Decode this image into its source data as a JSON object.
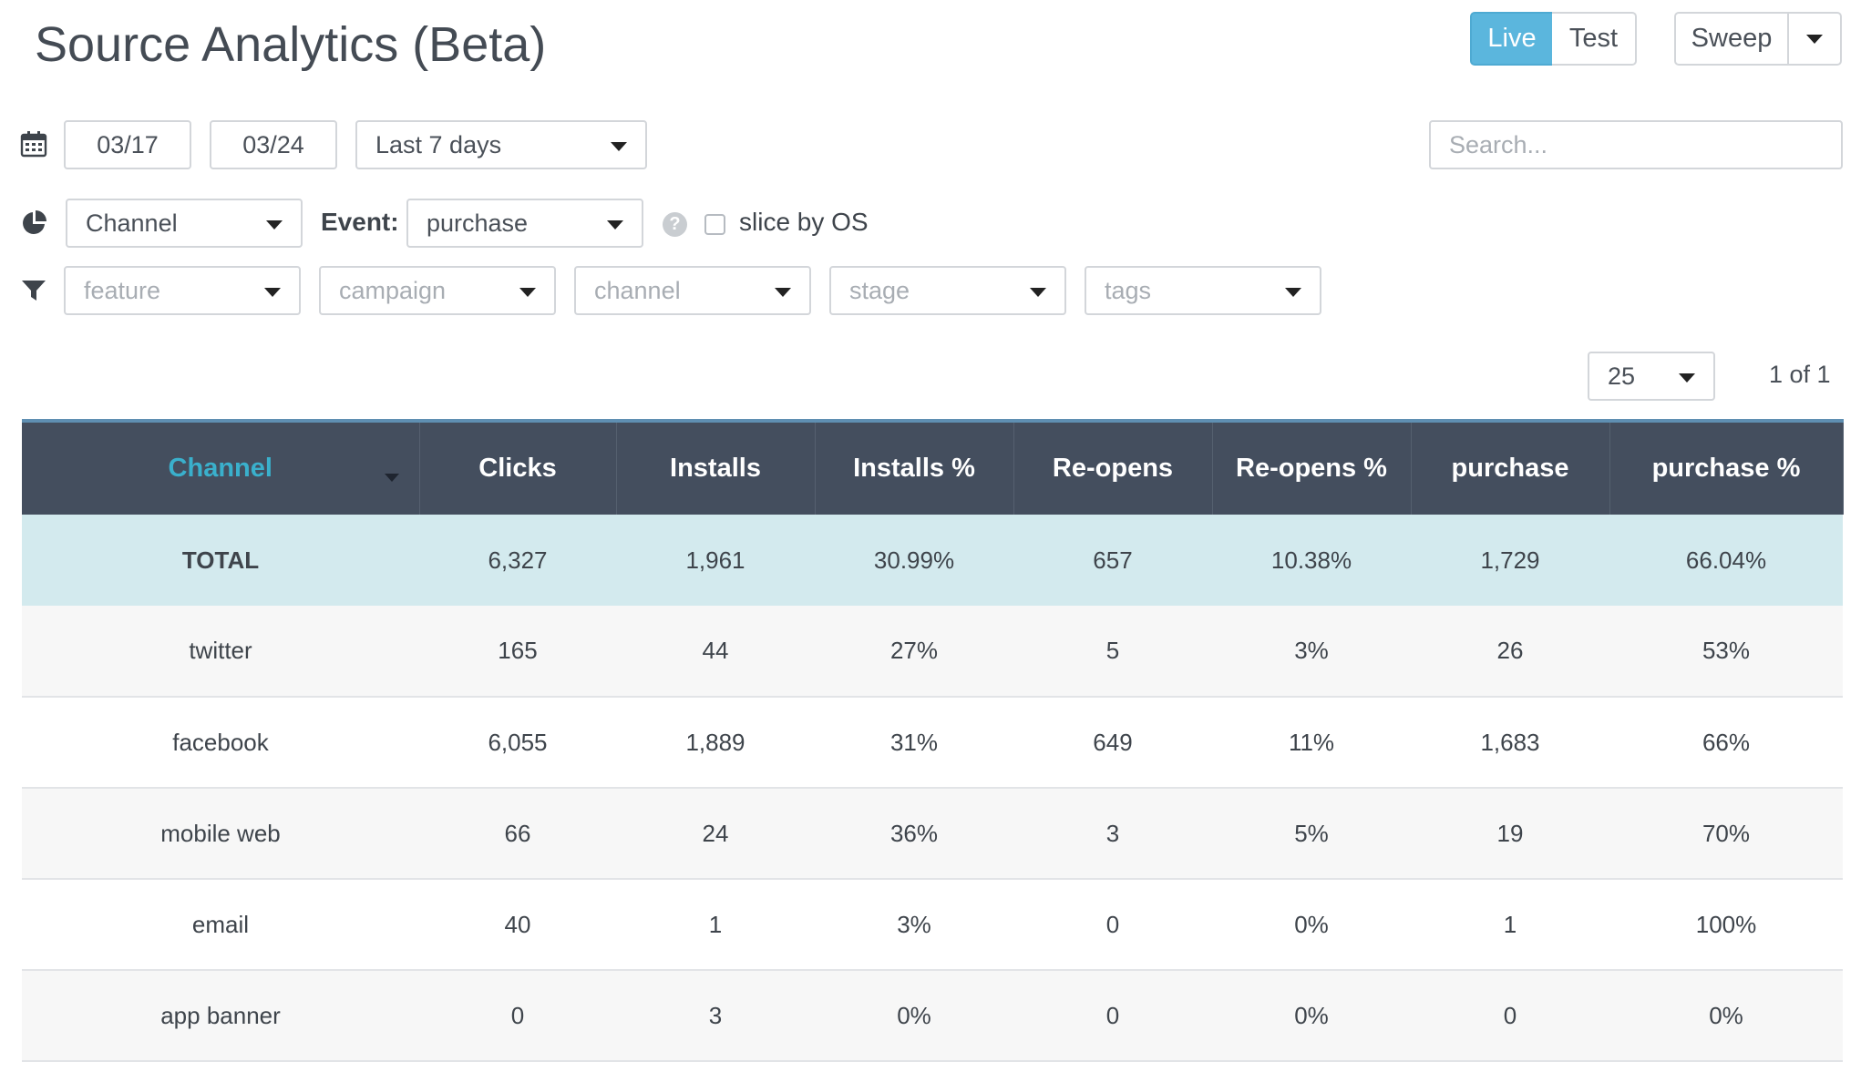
{
  "page": {
    "title": "Source Analytics (Beta)"
  },
  "mode_toggle": {
    "live": "Live",
    "test": "Test"
  },
  "sweep": {
    "label": "Sweep"
  },
  "date_range": {
    "start": "03/17",
    "end": "03/24",
    "preset": "Last 7 days"
  },
  "search": {
    "placeholder": "Search..."
  },
  "slice": {
    "dimension": "Channel",
    "event_label": "Event:",
    "event_value": "purchase",
    "slice_by_os_label": "slice by OS",
    "slice_by_os_checked": false
  },
  "filters": {
    "feature": "feature",
    "campaign": "campaign",
    "channel": "channel",
    "stage": "stage",
    "tags": "tags"
  },
  "pagination": {
    "page_size": "25",
    "page_info": "1 of 1"
  },
  "table": {
    "columns": [
      "Channel",
      "Clicks",
      "Installs",
      "Installs %",
      "Re-opens",
      "Re-opens %",
      "purchase",
      "purchase %"
    ],
    "sorted_column": "Channel",
    "total": [
      "TOTAL",
      "6,327",
      "1,961",
      "30.99%",
      "657",
      "10.38%",
      "1,729",
      "66.04%"
    ],
    "rows": [
      [
        "twitter",
        "165",
        "44",
        "27%",
        "5",
        "3%",
        "26",
        "53%"
      ],
      [
        "facebook",
        "6,055",
        "1,889",
        "31%",
        "649",
        "11%",
        "1,683",
        "66%"
      ],
      [
        "mobile web",
        "66",
        "24",
        "36%",
        "3",
        "5%",
        "19",
        "70%"
      ],
      [
        "email",
        "40",
        "1",
        "3%",
        "0",
        "0%",
        "1",
        "100%"
      ],
      [
        "app banner",
        "0",
        "3",
        "0%",
        "0",
        "0%",
        "0",
        "0%"
      ]
    ]
  },
  "colors": {
    "accent": "#5bb6dd",
    "header_bg": "#444e5e",
    "sorted_column_text": "#3ab0cc",
    "total_row_bg": "#d3eaee"
  },
  "icons": {
    "date": "calendar-icon",
    "slice": "pie-chart-icon",
    "filter": "filter-icon",
    "help": "question-circle-icon",
    "dropdown": "caret-down-icon"
  }
}
